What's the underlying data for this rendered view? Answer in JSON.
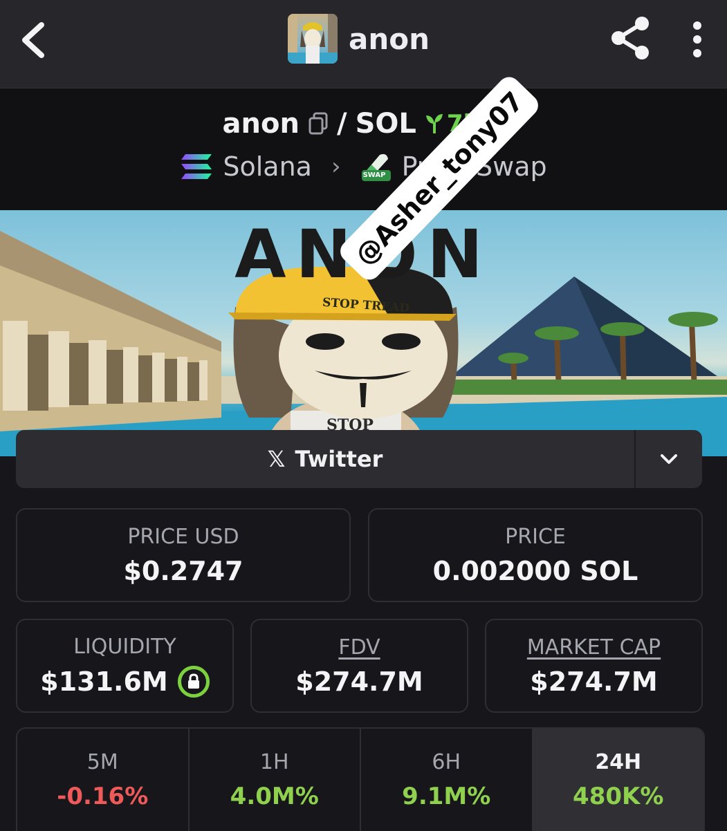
{
  "header": {
    "title": "anon",
    "icons": [
      "back-arrow-icon",
      "share-icon",
      "more-vertical-icon"
    ]
  },
  "pair": {
    "base": "anon",
    "separator": "/",
    "quote": "SOL",
    "age": "7h",
    "boost": "7",
    "chain": "Solana",
    "dex": "PumpSwap",
    "dex_badge": "SWAP"
  },
  "banner": {
    "title": "ANON",
    "hat_text": "STOP TREAD",
    "shirt_text": "STOP"
  },
  "watermark": "@Asher_tony07",
  "social": {
    "twitter_label": "Twitter"
  },
  "stats": {
    "price_usd_label": "PRICE USD",
    "price_usd": "$0.2747",
    "price_label": "PRICE",
    "price": "0.002000 SOL",
    "liquidity_label": "LIQUIDITY",
    "liquidity": "$131.6M",
    "fdv_label": "FDV",
    "fdv": "$274.7M",
    "mcap_label": "MARKET CAP",
    "mcap": "$274.7M"
  },
  "changes": [
    {
      "label": "5M",
      "value": "-0.16%",
      "color": "#ee5a5a"
    },
    {
      "label": "1H",
      "value": "4.0M%",
      "color": "#8fd14f"
    },
    {
      "label": "6H",
      "value": "9.1M%",
      "color": "#8fd14f"
    },
    {
      "label": "24H",
      "value": "480K%",
      "color": "#8fd14f"
    }
  ],
  "colors": {
    "positive": "#8fd14f",
    "negative": "#ee5a5a",
    "age": "#6fd24f",
    "boost": "#f29a33"
  }
}
